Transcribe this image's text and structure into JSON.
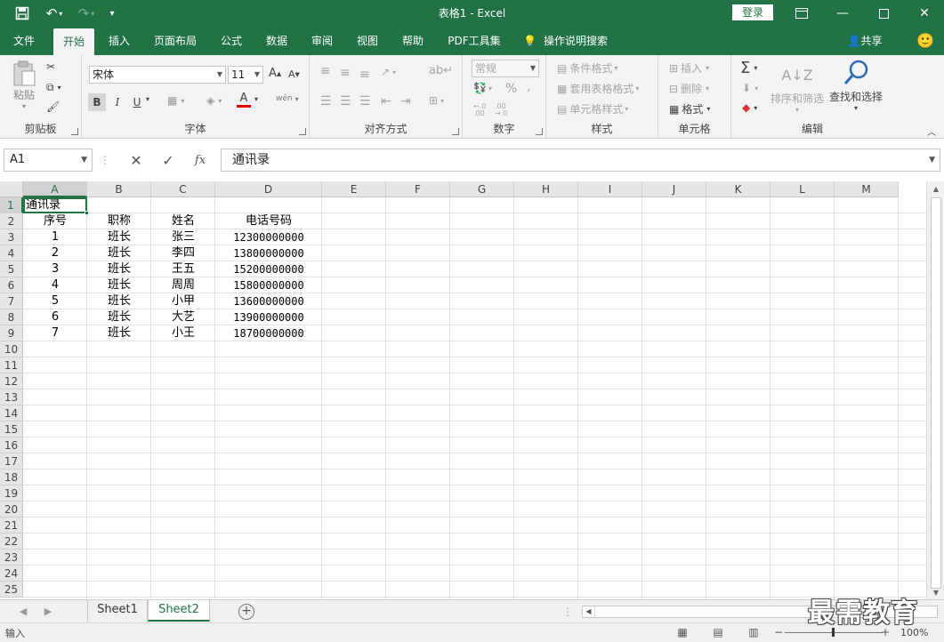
{
  "titlebar": {
    "title": "表格1 - Excel",
    "login": "登录"
  },
  "tabs": [
    "文件",
    "开始",
    "插入",
    "页面布局",
    "公式",
    "数据",
    "审阅",
    "视图",
    "帮助",
    "PDF工具集"
  ],
  "tell_me": "操作说明搜索",
  "share": "共享",
  "ribbon": {
    "clipboard": {
      "label": "剪贴板",
      "paste": "粘贴"
    },
    "font": {
      "label": "字体",
      "name": "宋体",
      "size": "11",
      "bold": "B",
      "italic": "I",
      "underline": "U",
      "font_color_glyph": "A",
      "phonetic": "wén"
    },
    "alignment": {
      "label": "对齐方式"
    },
    "number": {
      "label": "数字",
      "format": "常规",
      "percent": "%",
      "comma": ",",
      "inc": "←.0 .00",
      "dec": ".00 →.0"
    },
    "styles": {
      "label": "样式",
      "conditional": "条件格式",
      "table": "套用表格格式",
      "cell": "单元格样式"
    },
    "cells": {
      "label": "单元格",
      "insert": "插入",
      "delete": "删除",
      "format": "格式"
    },
    "editing": {
      "label": "编辑",
      "sort_filter": "排序和筛选",
      "find_select": "查找和选择"
    }
  },
  "formula_bar": {
    "name_box": "A1",
    "fx": "fx",
    "content": "通讯录"
  },
  "columns": [
    "A",
    "B",
    "C",
    "D",
    "E",
    "F",
    "G",
    "H",
    "I",
    "J",
    "K",
    "L",
    "M"
  ],
  "rows": [
    "1",
    "2",
    "3",
    "4",
    "5",
    "6",
    "7",
    "8",
    "9",
    "10",
    "11",
    "12",
    "13",
    "14",
    "15",
    "16",
    "17",
    "18",
    "19",
    "20",
    "21",
    "22",
    "23",
    "24",
    "25"
  ],
  "sheet": {
    "title": "通讯录",
    "headers": [
      "序号",
      "职称",
      "姓名",
      "电话号码"
    ],
    "records": [
      [
        "1",
        "班长",
        "张三",
        "12300000000"
      ],
      [
        "2",
        "班长",
        "李四",
        "13800000000"
      ],
      [
        "3",
        "班长",
        "王五",
        "15200000000"
      ],
      [
        "4",
        "班长",
        "周周",
        "15800000000"
      ],
      [
        "5",
        "班长",
        "小甲",
        "13600000000"
      ],
      [
        "6",
        "班长",
        "大艺",
        "13900000000"
      ],
      [
        "7",
        "班长",
        "小王",
        "18700000000"
      ]
    ]
  },
  "sheet_tabs": [
    "Sheet1",
    "Sheet2"
  ],
  "status": {
    "mode": "输入",
    "zoom": "100%"
  },
  "watermark": "最需教育",
  "colors": {
    "accent": "#217346"
  }
}
